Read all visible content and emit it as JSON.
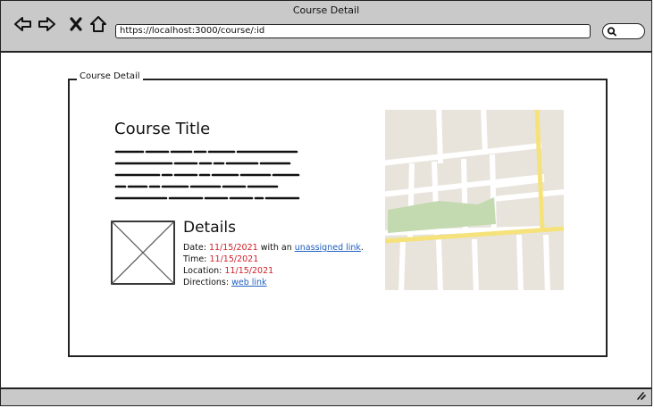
{
  "window": {
    "title": "Course Detail"
  },
  "browser": {
    "url": "https://localhost:3000/course/:id"
  },
  "fieldset": {
    "legend": "Course Detail"
  },
  "course": {
    "title": "Course Title"
  },
  "details": {
    "heading": "Details",
    "date_label": "Date: ",
    "date_value": "11/15/2021",
    "date_mid": " with an ",
    "date_link": "unassigned link",
    "date_end": ".",
    "time_label": "Time: ",
    "time_value": "11/15/2021",
    "location_label": "Location: ",
    "location_value": "11/15/2021",
    "directions_label": "Directions: ",
    "directions_link": "web link"
  },
  "icons": {
    "back": "arrow-left-icon",
    "forward": "arrow-right-icon",
    "stop": "close-icon",
    "home": "home-icon",
    "search": "search-icon",
    "image": "image-placeholder-icon",
    "map": "map-image",
    "resize": "resize-grip-icon"
  },
  "colors": {
    "chrome": "#c9c9c9",
    "value_red": "#d0202a",
    "link_blue": "#1f5fbf",
    "map_road": "#f5e27a",
    "map_park": "#c3d9b0"
  }
}
